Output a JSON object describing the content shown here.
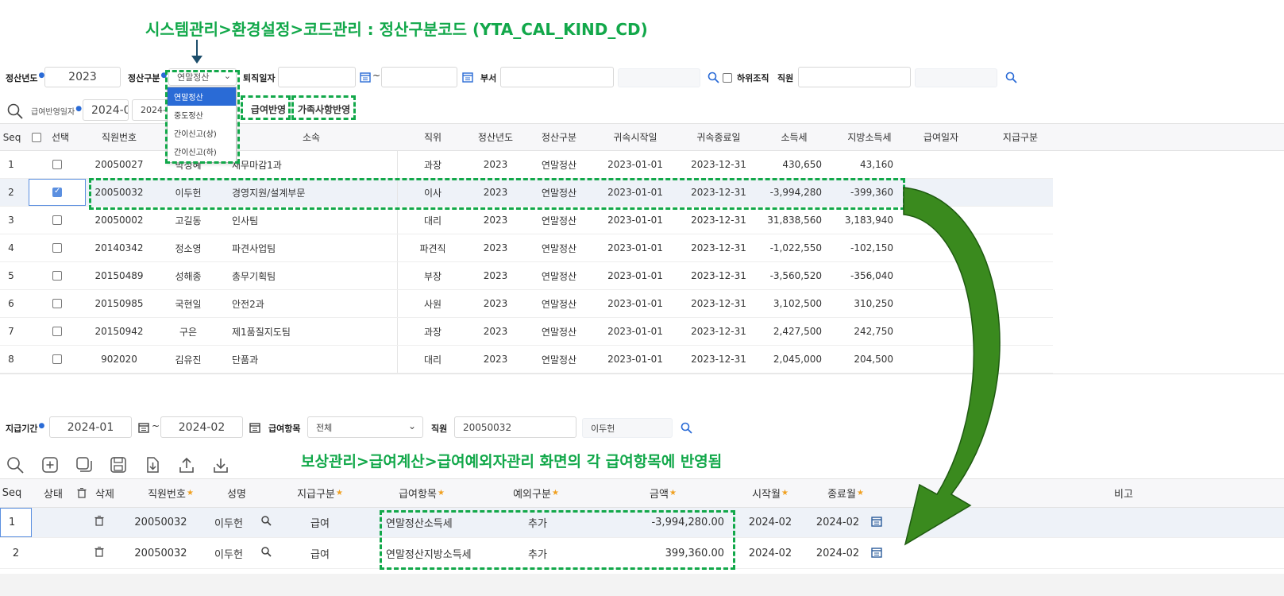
{
  "annotations": {
    "top": "시스템관리>환경설정>코드관리 : 정산구분코드 (YTA_CAL_KIND_CD)",
    "bottom": "보상관리>급여계산>급여예외자관리 화면의 각 급여항목에 반영됨"
  },
  "colors": {
    "annotation": "#12a84a",
    "accent": "#2a6bd6",
    "arrow": "#3a8a1e"
  },
  "filters1": {
    "year_label": "정산년도",
    "year_value": "2023",
    "kind_label": "정산구분",
    "kind_value": "연말정산",
    "retire_label": "퇴직일자",
    "tilde": "~",
    "dept_label": "부서",
    "sub_org_label": "하위조직",
    "employee_label": "직원"
  },
  "dropdown": {
    "options": [
      "연말정산",
      "중도정산",
      "간이신고(상)",
      "간이신고(하)"
    ],
    "selected": "연말정산"
  },
  "toolbar1": {
    "apply_date_label": "급여반영일자",
    "apply_date_value": "2024-0",
    "apply_date_value2": "2024-0",
    "pay_apply_button": "급여반영",
    "family_apply_button": "가족사항반영"
  },
  "grid1": {
    "headers": [
      "Seq",
      "선택",
      "직원번호",
      "성명",
      "소속",
      "직위",
      "정산년도",
      "정산구분",
      "귀속시작일",
      "귀속종료일",
      "소득세",
      "지방소득세",
      "급여일자",
      "지급구분"
    ],
    "rows": [
      {
        "seq": "1",
        "checked": false,
        "emp": "20050027",
        "name": "박정혜",
        "dept": "재무마감1과",
        "pos": "과장",
        "year": "2023",
        "kind": "연말정산",
        "start": "2023-01-01",
        "end": "2023-12-31",
        "tax": "430,650",
        "local": "43,160"
      },
      {
        "seq": "2",
        "checked": true,
        "emp": "20050032",
        "name": "이두헌",
        "dept": "경영지원/설계부문",
        "pos": "이사",
        "year": "2023",
        "kind": "연말정산",
        "start": "2023-01-01",
        "end": "2023-12-31",
        "tax": "-3,994,280",
        "local": "-399,360"
      },
      {
        "seq": "3",
        "checked": false,
        "emp": "20050002",
        "name": "고길동",
        "dept": "인사팀",
        "pos": "대리",
        "year": "2023",
        "kind": "연말정산",
        "start": "2023-01-01",
        "end": "2023-12-31",
        "tax": "31,838,560",
        "local": "3,183,940"
      },
      {
        "seq": "4",
        "checked": false,
        "emp": "20140342",
        "name": "정소영",
        "dept": "파견사업팀",
        "pos": "파견직",
        "year": "2023",
        "kind": "연말정산",
        "start": "2023-01-01",
        "end": "2023-12-31",
        "tax": "-1,022,550",
        "local": "-102,150"
      },
      {
        "seq": "5",
        "checked": false,
        "emp": "20150489",
        "name": "성해종",
        "dept": "총무기획팀",
        "pos": "부장",
        "year": "2023",
        "kind": "연말정산",
        "start": "2023-01-01",
        "end": "2023-12-31",
        "tax": "-3,560,520",
        "local": "-356,040"
      },
      {
        "seq": "6",
        "checked": false,
        "emp": "20150985",
        "name": "국현일",
        "dept": "안전2과",
        "pos": "사원",
        "year": "2023",
        "kind": "연말정산",
        "start": "2023-01-01",
        "end": "2023-12-31",
        "tax": "3,102,500",
        "local": "310,250"
      },
      {
        "seq": "7",
        "checked": false,
        "emp": "20150942",
        "name": "구은",
        "dept": "제1품질지도팀",
        "pos": "과장",
        "year": "2023",
        "kind": "연말정산",
        "start": "2023-01-01",
        "end": "2023-12-31",
        "tax": "2,427,500",
        "local": "242,750"
      },
      {
        "seq": "8",
        "checked": false,
        "emp": "902020",
        "name": "김유진",
        "dept": "단품과",
        "pos": "대리",
        "year": "2023",
        "kind": "연말정산",
        "start": "2023-01-01",
        "end": "2023-12-31",
        "tax": "2,045,000",
        "local": "204,500"
      }
    ]
  },
  "filters2": {
    "period_label": "지급기간",
    "period_from": "2024-01",
    "tilde": "~",
    "period_to": "2024-02",
    "item_label": "급여항목",
    "item_value": "전체",
    "employee_label": "직원",
    "employee_no": "20050032",
    "employee_name": "이두헌"
  },
  "grid2": {
    "headers": [
      "Seq",
      "상태",
      "삭제",
      "직원번호",
      "성명",
      "지급구분",
      "급여항목",
      "예외구분",
      "금액",
      "시작월",
      "종료월",
      "비고"
    ],
    "rows": [
      {
        "seq": "1",
        "emp": "20050032",
        "name": "이두헌",
        "pay_type": "급여",
        "item": "연말정산소득세",
        "exc": "추가",
        "amount": "-3,994,280.00",
        "start": "2024-02",
        "end": "2024-02"
      },
      {
        "seq": "2",
        "emp": "20050032",
        "name": "이두헌",
        "pay_type": "급여",
        "item": "연말정산지방소득세",
        "exc": "추가",
        "amount": "399,360.00",
        "start": "2024-02",
        "end": "2024-02"
      }
    ]
  }
}
